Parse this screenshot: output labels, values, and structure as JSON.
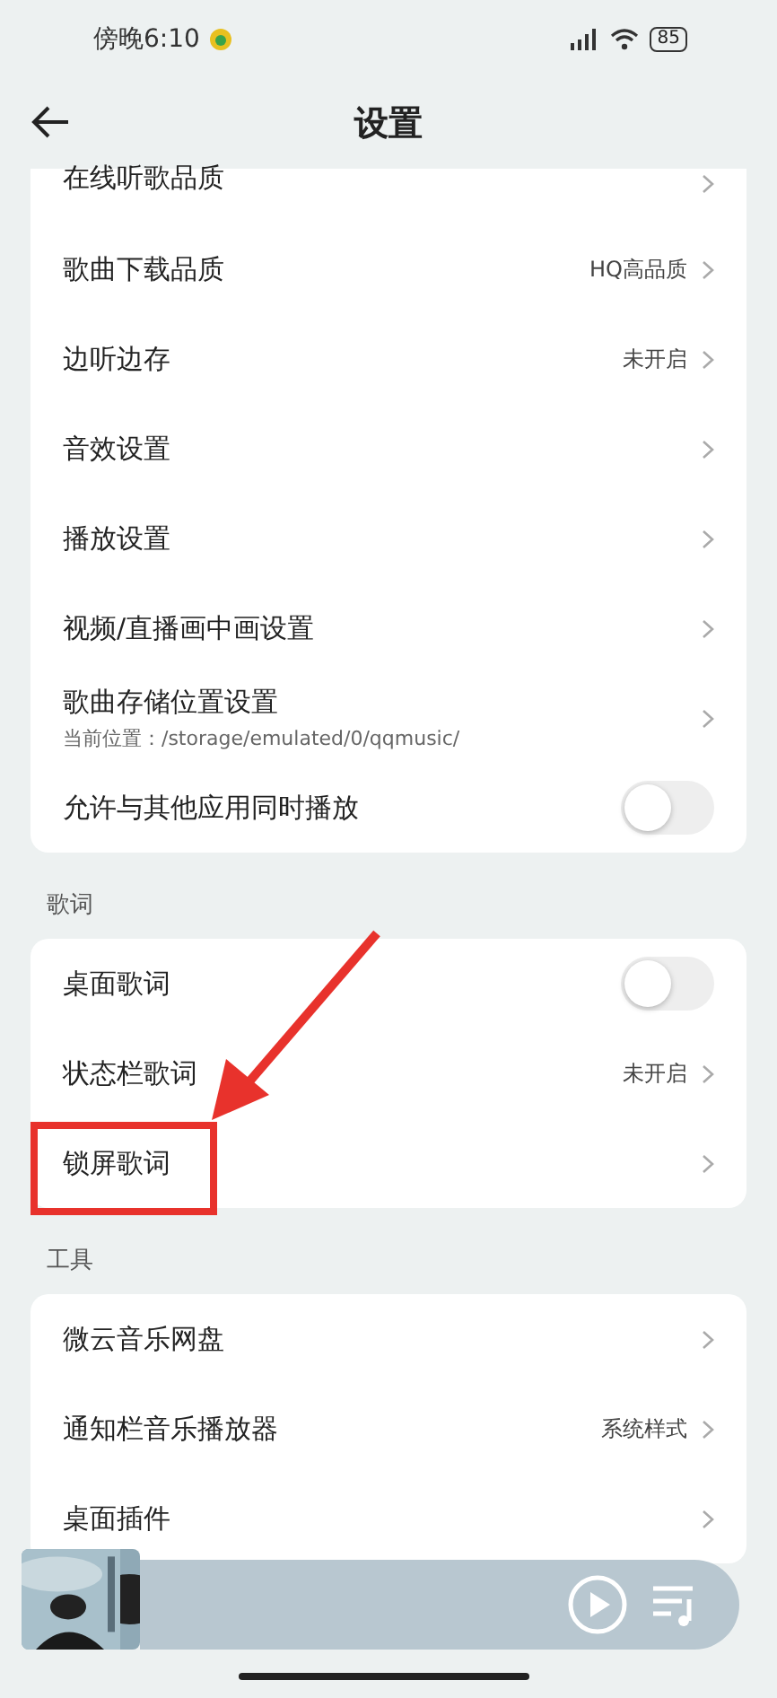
{
  "status_bar": {
    "time": "傍晚6:10",
    "battery": "85"
  },
  "header": {
    "title": "设置"
  },
  "groups": [
    {
      "items": [
        {
          "kind": "link",
          "label": "在线听歌品质"
        },
        {
          "kind": "link",
          "label": "歌曲下载品质",
          "value": "HQ高品质"
        },
        {
          "kind": "link",
          "label": "边听边存",
          "value": "未开启"
        },
        {
          "kind": "link",
          "label": "音效设置"
        },
        {
          "kind": "link",
          "label": "播放设置"
        },
        {
          "kind": "link",
          "label": "视频/直播画中画设置"
        },
        {
          "kind": "link",
          "label": "歌曲存储位置设置",
          "subtitle": "当前位置：/storage/emulated/0/qqmusic/"
        },
        {
          "kind": "toggle",
          "label": "允许与其他应用同时播放",
          "on": false
        }
      ]
    },
    {
      "title": "歌词",
      "items": [
        {
          "kind": "toggle",
          "label": "桌面歌词",
          "on": false
        },
        {
          "kind": "link",
          "label": "状态栏歌词",
          "value": "未开启"
        },
        {
          "kind": "link",
          "label": "锁屏歌词",
          "highlighted": true
        }
      ]
    },
    {
      "title": "工具",
      "items": [
        {
          "kind": "link",
          "label": "微云音乐网盘"
        },
        {
          "kind": "link",
          "label": "通知栏音乐播放器",
          "value": "系统样式"
        },
        {
          "kind": "link",
          "label": "桌面插件"
        }
      ]
    }
  ]
}
